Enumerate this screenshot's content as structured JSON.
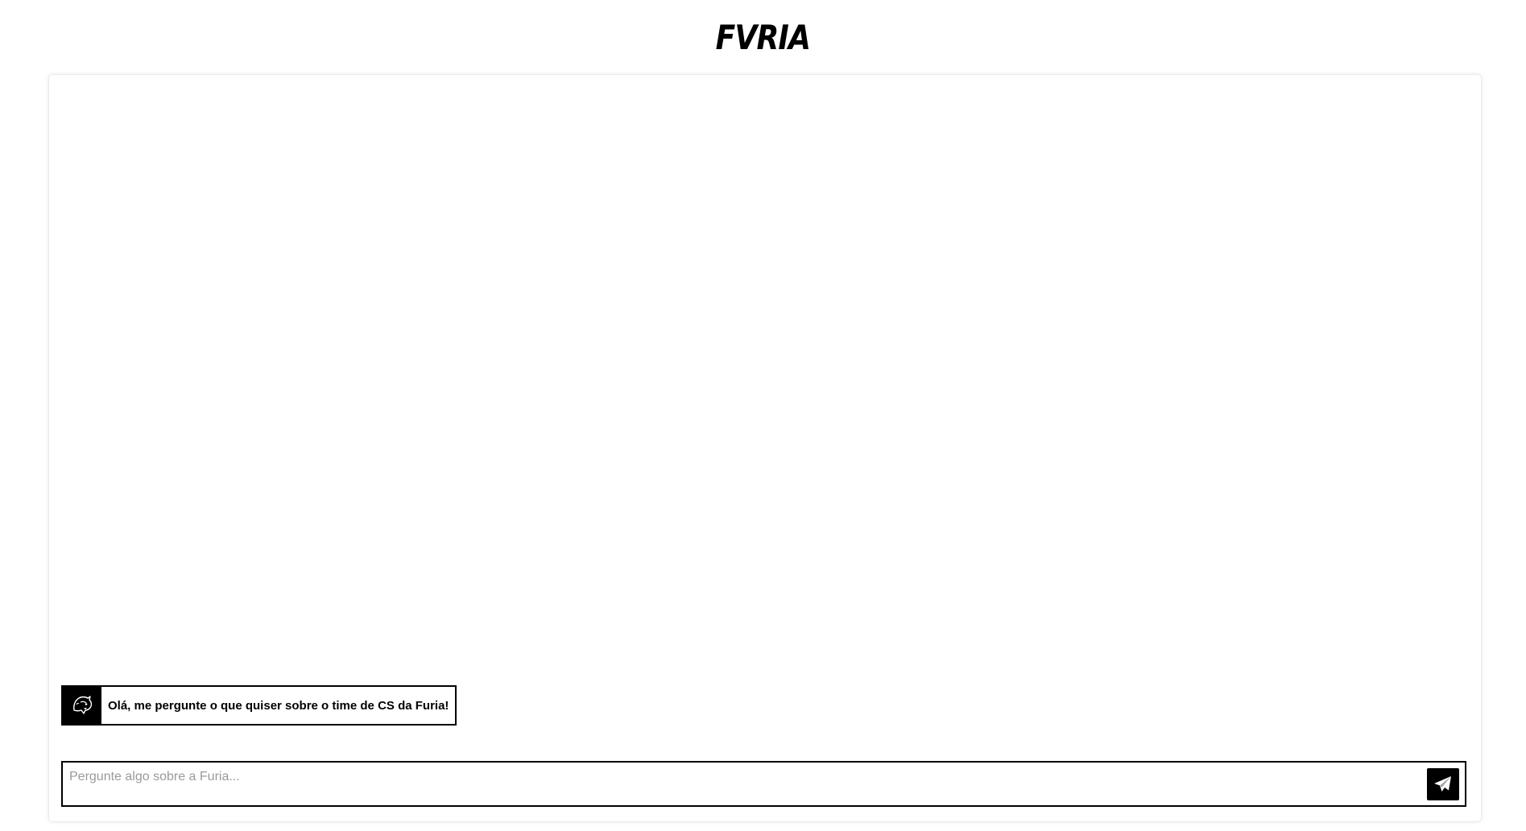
{
  "header": {
    "logo_text": "FVRIA"
  },
  "chat": {
    "messages": [
      {
        "sender": "bot",
        "avatar_icon": "panther-icon",
        "text": "Olá, me pergunte o que quiser sobre o time de CS da Furia!"
      }
    ]
  },
  "composer": {
    "placeholder": "Pergunte algo sobre a Furia...",
    "value": "",
    "send_icon": "paper-plane-icon"
  },
  "colors": {
    "primary": "#000000",
    "background": "#ffffff",
    "placeholder": "#9a9a9a"
  }
}
